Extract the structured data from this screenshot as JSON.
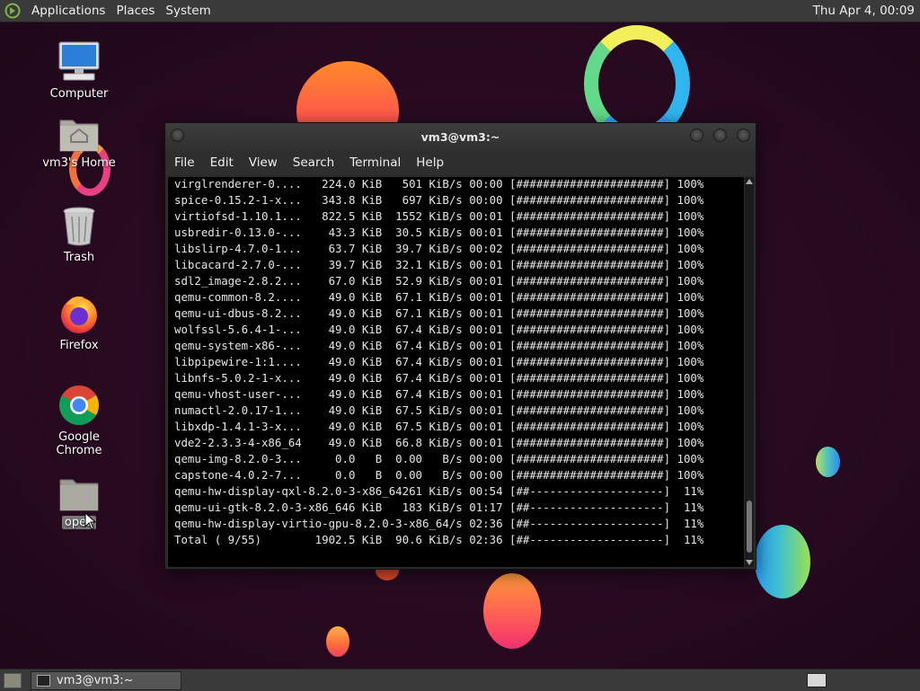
{
  "top_panel": {
    "menus": [
      "Applications",
      "Places",
      "System"
    ],
    "clock": "Thu Apr  4, 00:09"
  },
  "desktop_icons": [
    {
      "label": "Computer"
    },
    {
      "label": "vm3's Home"
    },
    {
      "label": "Trash"
    },
    {
      "label": "Firefox"
    },
    {
      "label": "Google Chrome"
    },
    {
      "label": "opea"
    }
  ],
  "window": {
    "title": "vm3@vm3:~",
    "menu": [
      "File",
      "Edit",
      "View",
      "Search",
      "Terminal",
      "Help"
    ],
    "terminal_lines": [
      "virglrenderer-0....   224.0 KiB   501 KiB/s 00:00 [######################] 100%",
      "spice-0.15.2-1-x...   343.8 KiB   697 KiB/s 00:00 [######################] 100%",
      "virtiofsd-1.10.1...   822.5 KiB  1552 KiB/s 00:01 [######################] 100%",
      "usbredir-0.13.0-...    43.3 KiB  30.5 KiB/s 00:01 [######################] 100%",
      "libslirp-4.7.0-1...    63.7 KiB  39.7 KiB/s 00:02 [######################] 100%",
      "libcacard-2.7.0-...    39.7 KiB  32.1 KiB/s 00:01 [######################] 100%",
      "sdl2_image-2.8.2...    67.0 KiB  52.9 KiB/s 00:01 [######################] 100%",
      "qemu-common-8.2....    49.0 KiB  67.1 KiB/s 00:01 [######################] 100%",
      "qemu-ui-dbus-8.2...    49.0 KiB  67.1 KiB/s 00:01 [######################] 100%",
      "wolfssl-5.6.4-1-...    49.0 KiB  67.4 KiB/s 00:01 [######################] 100%",
      "qemu-system-x86-...    49.0 KiB  67.4 KiB/s 00:01 [######################] 100%",
      "libpipewire-1:1....    49.0 KiB  67.4 KiB/s 00:01 [######################] 100%",
      "libnfs-5.0.2-1-x...    49.0 KiB  67.4 KiB/s 00:01 [######################] 100%",
      "qemu-vhost-user-...    49.0 KiB  67.4 KiB/s 00:01 [######################] 100%",
      "numactl-2.0.17-1...    49.0 KiB  67.5 KiB/s 00:01 [######################] 100%",
      "libxdp-1.4.1-3-x...    49.0 KiB  67.5 KiB/s 00:01 [######################] 100%",
      "vde2-2.3.3-4-x86_64    49.0 KiB  66.8 KiB/s 00:01 [######################] 100%",
      "qemu-img-8.2.0-3...     0.0   B  0.00   B/s 00:00 [######################] 100%",
      "capstone-4.0.2-7...     0.0   B  0.00   B/s 00:00 [######################] 100%",
      "qemu-hw-display-qxl-8.2.0-3-x86_64261 KiB/s 00:54 [##--------------------]  11%",
      "qemu-ui-gtk-8.2.0-3-x86_646 KiB   183 KiB/s 01:17 [##--------------------]  11%",
      "qemu-hw-display-virtio-gpu-8.2.0-3-x86_64/s 02:36 [##--------------------]  11%",
      "Total ( 9/55)        1902.5 KiB  90.6 KiB/s 02:36 [##--------------------]  11%"
    ]
  },
  "taskbar": {
    "task_label": "vm3@vm3:~"
  }
}
